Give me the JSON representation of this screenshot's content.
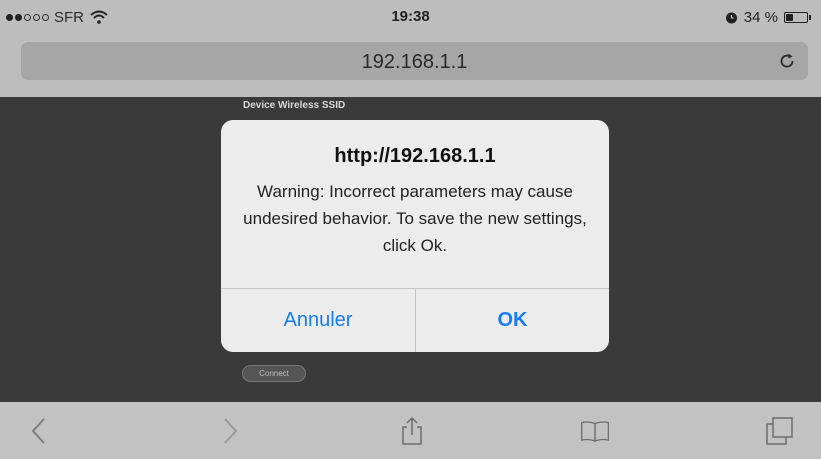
{
  "status_bar": {
    "carrier": "SFR",
    "signal_bars_filled": 2,
    "signal_bars_total": 5,
    "time": "19:38",
    "battery_text": "34 %",
    "battery_level": 0.34
  },
  "address_bar": {
    "url": "192.168.1.1",
    "reload_icon": "reload-icon"
  },
  "page": {
    "ssid_label": "Device Wireless SSID",
    "connect_label": "Connect"
  },
  "alert": {
    "title": "http://192.168.1.1",
    "message": "Warning: Incorrect parameters may cause undesired behavior. To save the new settings, click Ok.",
    "cancel_label": "Annuler",
    "ok_label": "OK",
    "button_color": "#1a7cf5"
  },
  "toolbar": {
    "icons": [
      "back-icon",
      "forward-icon",
      "share-icon",
      "bookmarks-icon",
      "tabs-icon"
    ]
  }
}
